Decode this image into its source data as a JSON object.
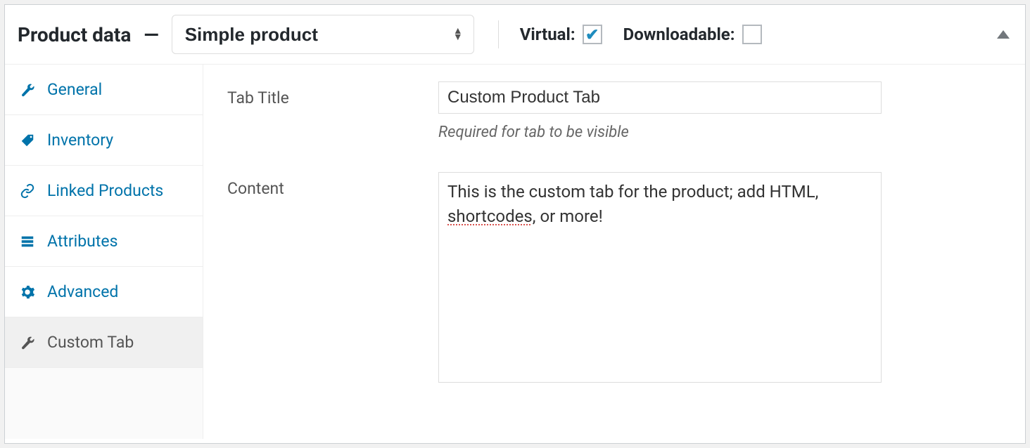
{
  "header": {
    "title": "Product data",
    "dash": "—",
    "product_type": "Simple product",
    "virtual_label": "Virtual:",
    "virtual_checked": true,
    "downloadable_label": "Downloadable:",
    "downloadable_checked": false
  },
  "tabs": [
    {
      "id": "general",
      "label": "General",
      "icon": "wrench",
      "active": false
    },
    {
      "id": "inventory",
      "label": "Inventory",
      "icon": "tag",
      "active": false
    },
    {
      "id": "linked",
      "label": "Linked Products",
      "icon": "link",
      "active": false
    },
    {
      "id": "attributes",
      "label": "Attributes",
      "icon": "list",
      "active": false
    },
    {
      "id": "advanced",
      "label": "Advanced",
      "icon": "gear",
      "active": false
    },
    {
      "id": "customtab",
      "label": "Custom Tab",
      "icon": "wrench-grey",
      "active": true
    }
  ],
  "form": {
    "tab_title_label": "Tab Title",
    "tab_title_value": "Custom Product Tab",
    "tab_title_desc": "Required for tab to be visible",
    "content_label": "Content",
    "content_value_pre": "This is the custom tab for the product; add HTML, ",
    "content_value_squiggle": "shortcodes",
    "content_value_post": ", or more!"
  }
}
